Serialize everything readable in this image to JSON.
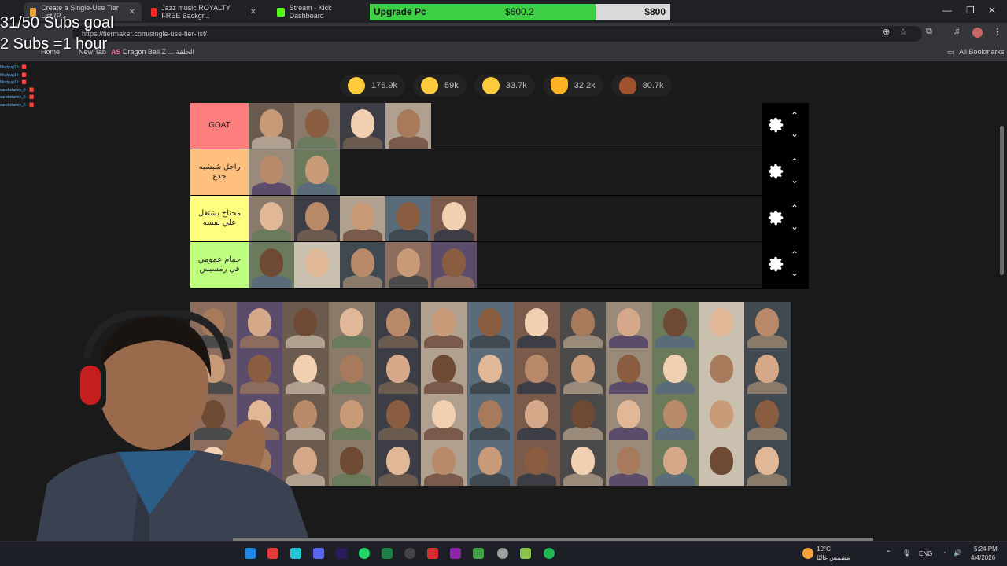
{
  "overlay": {
    "subs_goal": "31/50 Subs goal",
    "subs_rule": "2 Subs =1 hour",
    "chat_lines": [
      {
        "user": "Modyug19 :",
        "tag": "🟥"
      },
      {
        "user": "Modyug19 :",
        "tag": "🟥"
      },
      {
        "user": "Modyug19 :",
        "tag": "🟥"
      },
      {
        "user": "sarahelamin_6 :",
        "tag": "🟥"
      },
      {
        "user": "sarahelamin_6 :",
        "tag": "🟥"
      },
      {
        "user": "sarahelamin_6 :",
        "tag": "🟥"
      }
    ]
  },
  "tabs": [
    {
      "label": "Create a Single-Use Tier List (P...",
      "active": true,
      "color": "#e8a33d"
    },
    {
      "label": "Jazz music ROYALTY FREE Backgr...",
      "active": false,
      "color": "#ff2a2a"
    },
    {
      "label": "Stream - Kick Dashboard",
      "active": false,
      "color": "#53fc18"
    }
  ],
  "upgrade": {
    "label": "Upgrade Pc",
    "current": "$600.2",
    "goal": "$800",
    "progress": 0.7503
  },
  "address": {
    "url": "https://tiermaker.com/single-use-tier-list/"
  },
  "bookmarks": {
    "home": "Home",
    "new_tab": "New Tab",
    "dbz_badge": "AS",
    "dbz": "Dragon Ball Z ... الحلقة",
    "all": "All Bookmarks"
  },
  "reactions": [
    {
      "count": "176.9k",
      "icon": "grin-face-icon",
      "color": "#ffcb3d"
    },
    {
      "count": "59k",
      "icon": "heart-eyes-icon",
      "color": "#ffcb3d"
    },
    {
      "count": "33.7k",
      "icon": "laughing-face-icon",
      "color": "#ffcb3d"
    },
    {
      "count": "32.2k",
      "icon": "raised-hands-icon",
      "color": "#ffb224"
    },
    {
      "count": "80.7k",
      "icon": "poop-icon",
      "color": "#a0522d"
    }
  ],
  "tiers": [
    {
      "label": "GOAT",
      "color": "#ff7f7f",
      "items": 4
    },
    {
      "label": "راجل شبشبه جدع",
      "color": "#ffbf7f",
      "items": 2
    },
    {
      "label": "محتاج يشتغل علي نفسه",
      "color": "#ffff7f",
      "items": 5
    },
    {
      "label": "حمام عمومي في رمسيس",
      "color": "#bfff7f",
      "items": 5
    }
  ],
  "pool": {
    "count": 52
  },
  "taskbar": {
    "weather_temp": "19°C",
    "weather_desc": "مشمس غالبًا",
    "lang": "ENG",
    "time": "5:24 PM",
    "date": "4/4/2026"
  }
}
